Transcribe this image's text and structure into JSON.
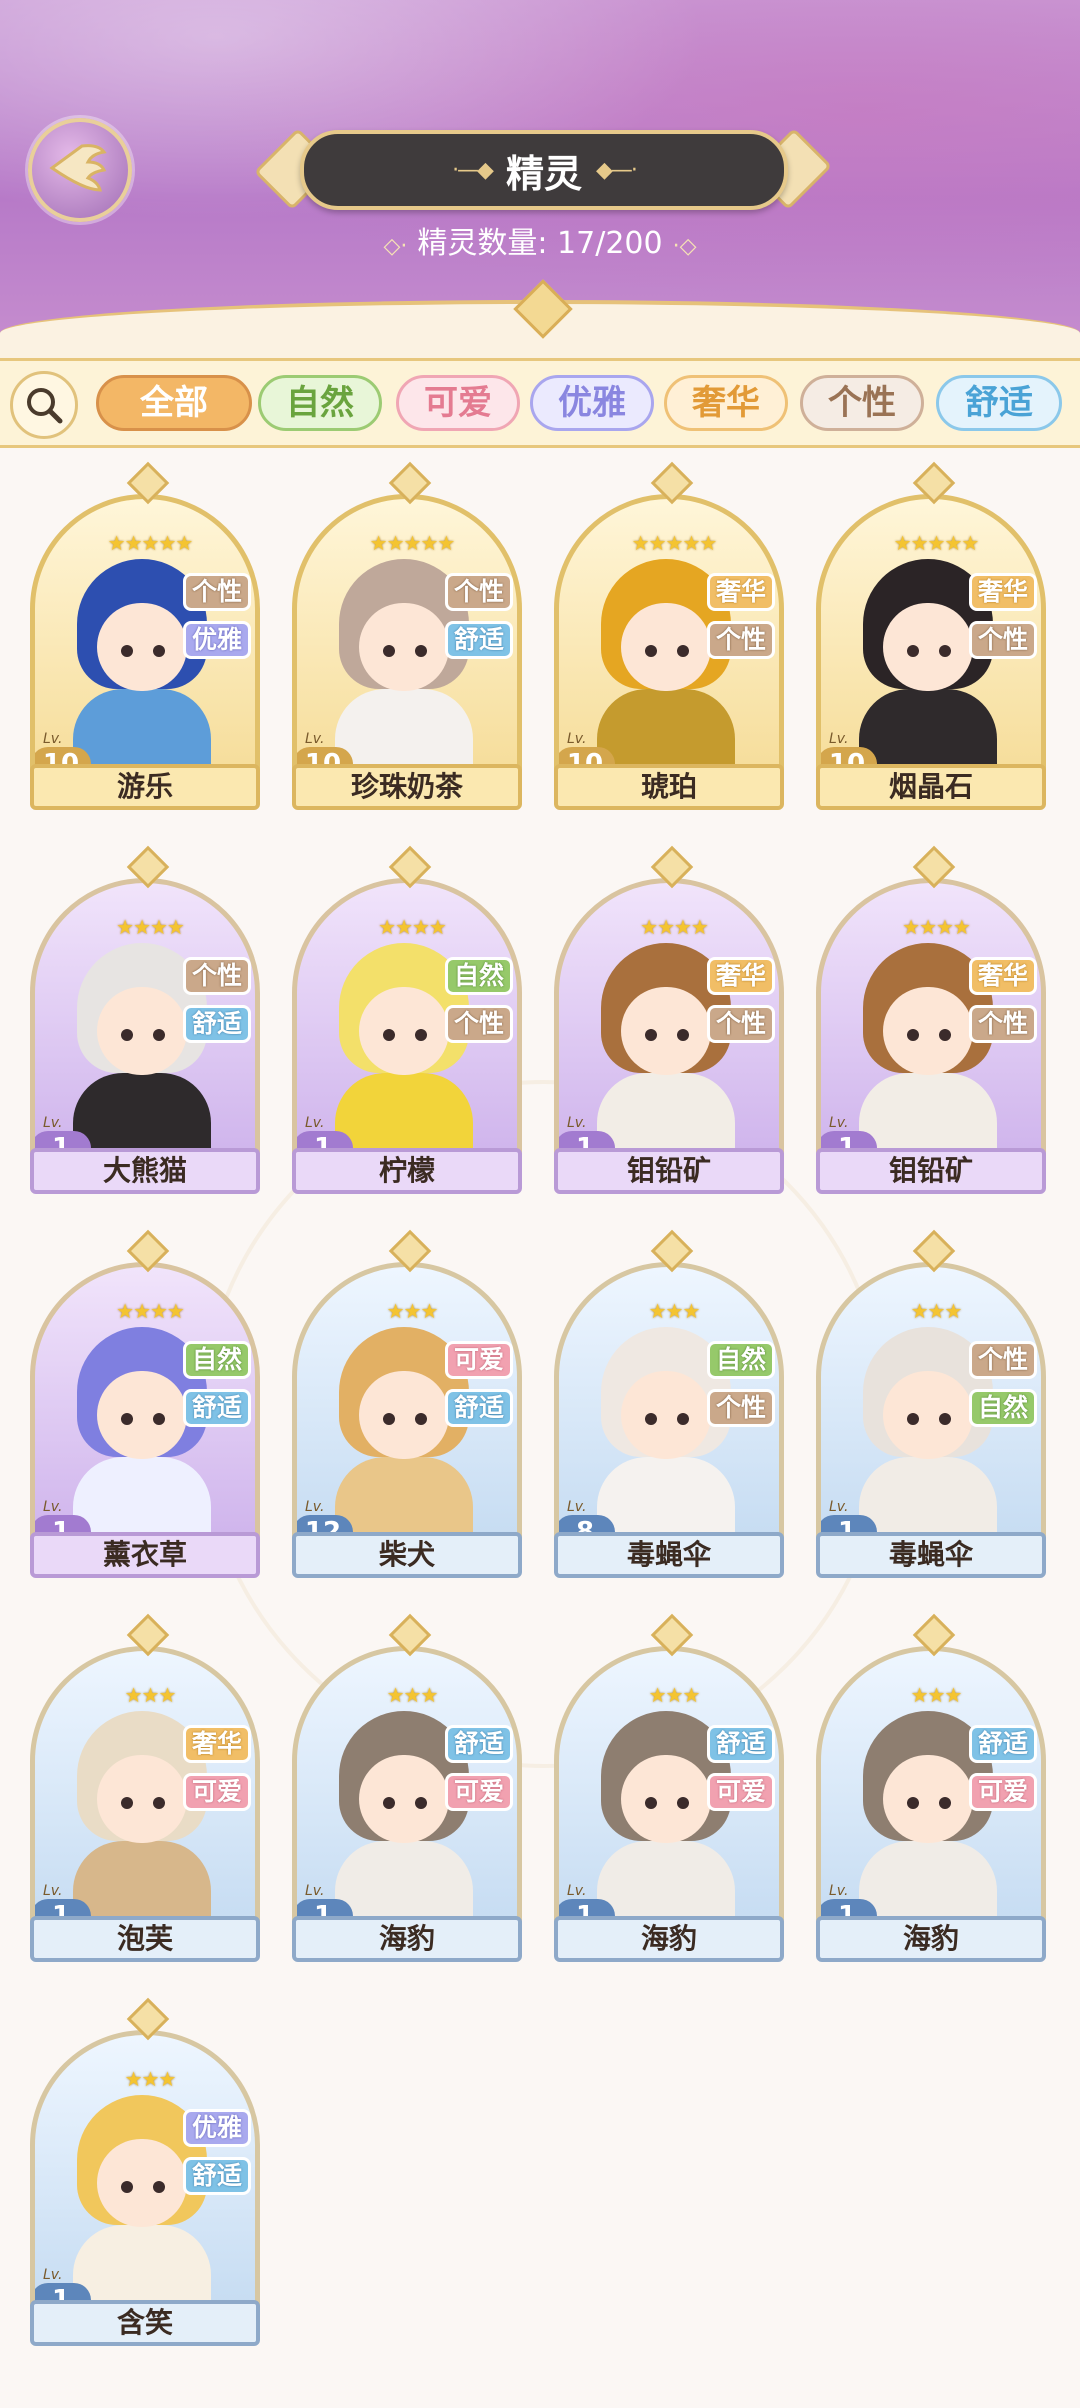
{
  "header": {
    "title": "精灵",
    "count_label": "精灵数量: 17/200"
  },
  "filters": [
    {
      "label": "全部",
      "active": true,
      "bg": "#f3b766",
      "border": "#d8914a",
      "color": "#ffffff"
    },
    {
      "label": "自然",
      "active": false,
      "bg": "#e8f6d8",
      "border": "#9ccb73",
      "color": "#6aa43e"
    },
    {
      "label": "可爱",
      "active": false,
      "bg": "#fde6ea",
      "border": "#f0a6b4",
      "color": "#e47b91"
    },
    {
      "label": "优雅",
      "active": false,
      "bg": "#ebeafe",
      "border": "#a9a6ee",
      "color": "#8a86e0"
    },
    {
      "label": "奢华",
      "active": false,
      "bg": "#fff0d6",
      "border": "#efc176",
      "color": "#e29a37"
    },
    {
      "label": "个性",
      "active": false,
      "bg": "#f5ece4",
      "border": "#cfb099",
      "color": "#9a7355"
    },
    {
      "label": "舒适",
      "active": false,
      "bg": "#e4f3fc",
      "border": "#8bc8ea",
      "color": "#4aa3d6"
    }
  ],
  "cards": [
    {
      "name": "游乐",
      "level": "10",
      "stars": "★★★★★",
      "rarity": "r5",
      "tags": [
        "个性",
        "优雅"
      ],
      "hair": "#2d4fb0",
      "outfit": "#5d9dd9"
    },
    {
      "name": "珍珠奶茶",
      "level": "10",
      "stars": "★★★★★",
      "rarity": "r5",
      "tags": [
        "个性",
        "舒适"
      ],
      "hair": "#bfa89a",
      "outfit": "#f4f1ee"
    },
    {
      "name": "琥珀",
      "level": "10",
      "stars": "★★★★★",
      "rarity": "r5",
      "tags": [
        "奢华",
        "个性"
      ],
      "hair": "#e5a622",
      "outfit": "#c59b2e"
    },
    {
      "name": "烟晶石",
      "level": "10",
      "stars": "★★★★★",
      "rarity": "r5",
      "tags": [
        "奢华",
        "个性"
      ],
      "hair": "#2b2426",
      "outfit": "#2f2a2c"
    },
    {
      "name": "大熊猫",
      "level": "1",
      "stars": "★★★★",
      "rarity": "r4",
      "tags": [
        "个性",
        "舒适"
      ],
      "hair": "#e7e4e2",
      "outfit": "#2e2a2c"
    },
    {
      "name": "柠檬",
      "level": "1",
      "stars": "★★★★",
      "rarity": "r4",
      "tags": [
        "自然",
        "个性"
      ],
      "hair": "#f3e06a",
      "outfit": "#f2d43a"
    },
    {
      "name": "钼铅矿",
      "level": "1",
      "stars": "★★★★",
      "rarity": "r4",
      "tags": [
        "奢华",
        "个性"
      ],
      "hair": "#a9703d",
      "outfit": "#f2ede6"
    },
    {
      "name": "钼铅矿",
      "level": "1",
      "stars": "★★★★",
      "rarity": "r4",
      "tags": [
        "奢华",
        "个性"
      ],
      "hair": "#a9703d",
      "outfit": "#f2ede6"
    },
    {
      "name": "薰衣草",
      "level": "1",
      "stars": "★★★★",
      "rarity": "r4",
      "tags": [
        "自然",
        "舒适"
      ],
      "hair": "#7f7fe0",
      "outfit": "#eef0ff"
    },
    {
      "name": "柴犬",
      "level": "12",
      "stars": "★★★",
      "rarity": "r3",
      "tags": [
        "可爱",
        "舒适"
      ],
      "hair": "#e2b064",
      "outfit": "#e9c689"
    },
    {
      "name": "毒蝇伞",
      "level": "8",
      "stars": "★★★",
      "rarity": "r3",
      "tags": [
        "自然",
        "个性"
      ],
      "hair": "#efe8e2",
      "outfit": "#f5f2ef"
    },
    {
      "name": "毒蝇伞",
      "level": "1",
      "stars": "★★★",
      "rarity": "r3",
      "tags": [
        "个性",
        "自然"
      ],
      "hair": "#e8e2dc",
      "outfit": "#f1ece6"
    },
    {
      "name": "泡芙",
      "level": "1",
      "stars": "★★★",
      "rarity": "r3",
      "tags": [
        "奢华",
        "可爱"
      ],
      "hair": "#e9dcc6",
      "outfit": "#d7b78b"
    },
    {
      "name": "海豹",
      "level": "1",
      "stars": "★★★",
      "rarity": "r3",
      "tags": [
        "舒适",
        "可爱"
      ],
      "hair": "#8e7e70",
      "outfit": "#f0ece7"
    },
    {
      "name": "海豹",
      "level": "1",
      "stars": "★★★",
      "rarity": "r3",
      "tags": [
        "舒适",
        "可爱"
      ],
      "hair": "#8e7e70",
      "outfit": "#f0ece7"
    },
    {
      "name": "海豹",
      "level": "1",
      "stars": "★★★",
      "rarity": "r3",
      "tags": [
        "舒适",
        "可爱"
      ],
      "hair": "#8e7e70",
      "outfit": "#f0ece7"
    },
    {
      "name": "含笑",
      "level": "1",
      "stars": "★★★",
      "rarity": "r3",
      "tags": [
        "优雅",
        "舒适"
      ],
      "hair": "#f1c75c",
      "outfit": "#f7efe2"
    }
  ],
  "level_prefix": "Lv.",
  "icons": {
    "back": "back-wing-icon",
    "search": "search-icon",
    "crest": "diamond-crest-icon"
  }
}
